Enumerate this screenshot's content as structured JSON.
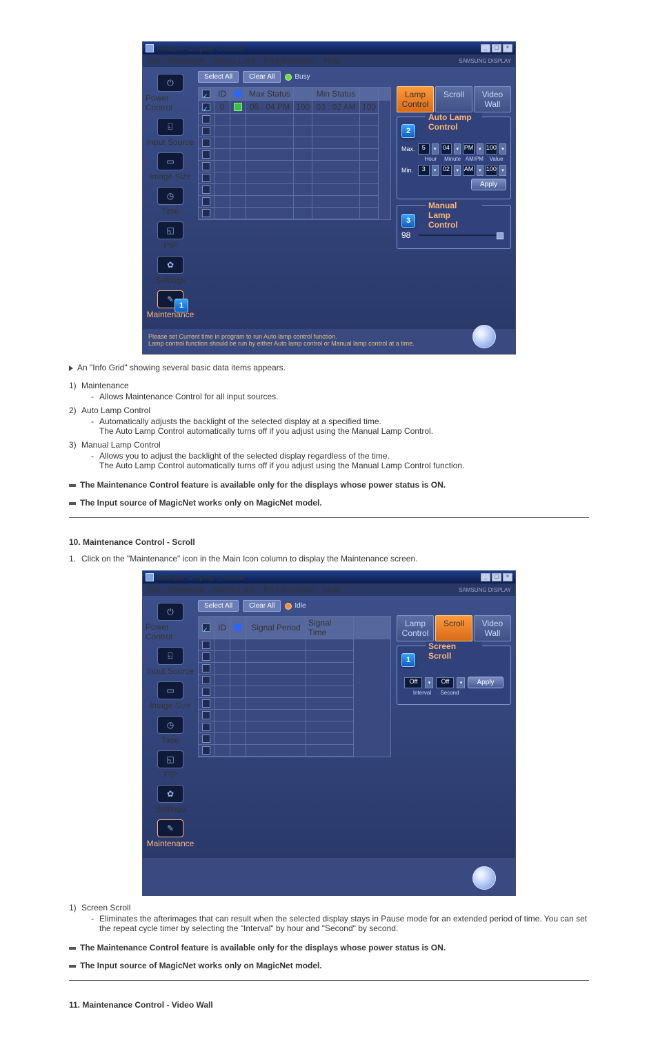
{
  "app": {
    "title": "Multiple Display Control",
    "menu": [
      "File",
      "Remocon",
      "Safety Lock",
      "Port Selection",
      "Help"
    ],
    "brand": "SAMSUNG DISPLAY"
  },
  "sidebar": {
    "items": [
      {
        "label": "Power Control"
      },
      {
        "label": "Input Source"
      },
      {
        "label": "Image Size"
      },
      {
        "label": "Time"
      },
      {
        "label": "PIP"
      },
      {
        "label": "Settings"
      },
      {
        "label": "Maintenance"
      }
    ]
  },
  "toolbar": {
    "select_all": "Select All",
    "clear_all": "Clear All",
    "busy": "Busy",
    "idle": "Idle"
  },
  "grid1": {
    "headers": {
      "max_status": "Max Status",
      "min_status": "Min Status"
    },
    "row": {
      "max_time": "05 : 04 PM",
      "max_val": "100",
      "min_time": "03 : 02 AM",
      "min_val": "100"
    }
  },
  "grid2": {
    "headers": {
      "signal_period": "Signal Period",
      "signal_time": "Signal Time"
    }
  },
  "panel1": {
    "tabs": {
      "lamp": "Lamp Control",
      "scroll": "Scroll",
      "video": "Video Wall"
    },
    "auto_legend": "Auto Lamp Control",
    "manual_legend": "Manual Lamp Control",
    "max": "Max.",
    "min": "Min.",
    "max_h": "5",
    "max_m": "04",
    "max_ap": "PM",
    "max_v": "100",
    "min_h": "3",
    "min_m": "02",
    "min_ap": "AM",
    "min_v": "100",
    "sub_h": "Hour",
    "sub_m": "Minute",
    "sub_ap": "AM/PM",
    "sub_v": "Value",
    "apply": "Apply",
    "manual_val": "98"
  },
  "panel2": {
    "tabs": {
      "lamp": "Lamp Control",
      "scroll": "Scroll",
      "video": "Video Wall"
    },
    "scroll_legend": "Screen Scroll",
    "interval_val": "Off",
    "second_val": "Off",
    "interval": "Interval",
    "second": "Second",
    "apply": "Apply"
  },
  "footer1": {
    "line1": "Please set Current time in program to run Auto lamp control function.",
    "line2": "Lamp control function should be run by either Auto lamp control or Manual lamp control at a time."
  },
  "doc": {
    "intro_arrow": "An \"Info Grid\" showing several basic data items appears.",
    "i1_title": "Maintenance",
    "i1_sub": "Allows Maintenance Control for all input sources.",
    "i2_title": "Auto Lamp Control",
    "i2_sub1": "Automatically adjusts the backlight of the selected display at a specified time.",
    "i2_sub2": "The Auto Lamp Control automatically turns off if you adjust using the Manual Lamp Control.",
    "i3_title": "Manual Lamp Control",
    "i3_sub1": "Allows you to adjust the backlight of the selected display regardless of the time.",
    "i3_sub2": "The Auto Lamp Control automatically turns off if you adjust using the Manual Lamp Control function.",
    "note1": "The Maintenance Control feature is available only for the displays whose power status is ON.",
    "note2": "The Input source of MagicNet works only on MagicNet model.",
    "sec10_title": "10. Maintenance Control - Scroll",
    "sec10_step": "Click on the \"Maintenance\" icon in the Main Icon column to display the Maintenance screen.",
    "s1_title": "Screen Scroll",
    "s1_sub": "Eliminates the afterimages that can result when the selected display stays in Pause mode for an extended period of time. You can set the repeat cycle timer by selecting the \"Interval\" by hour and \"Second\" by second.",
    "sec11_title": "11. Maintenance Control - Video Wall"
  }
}
